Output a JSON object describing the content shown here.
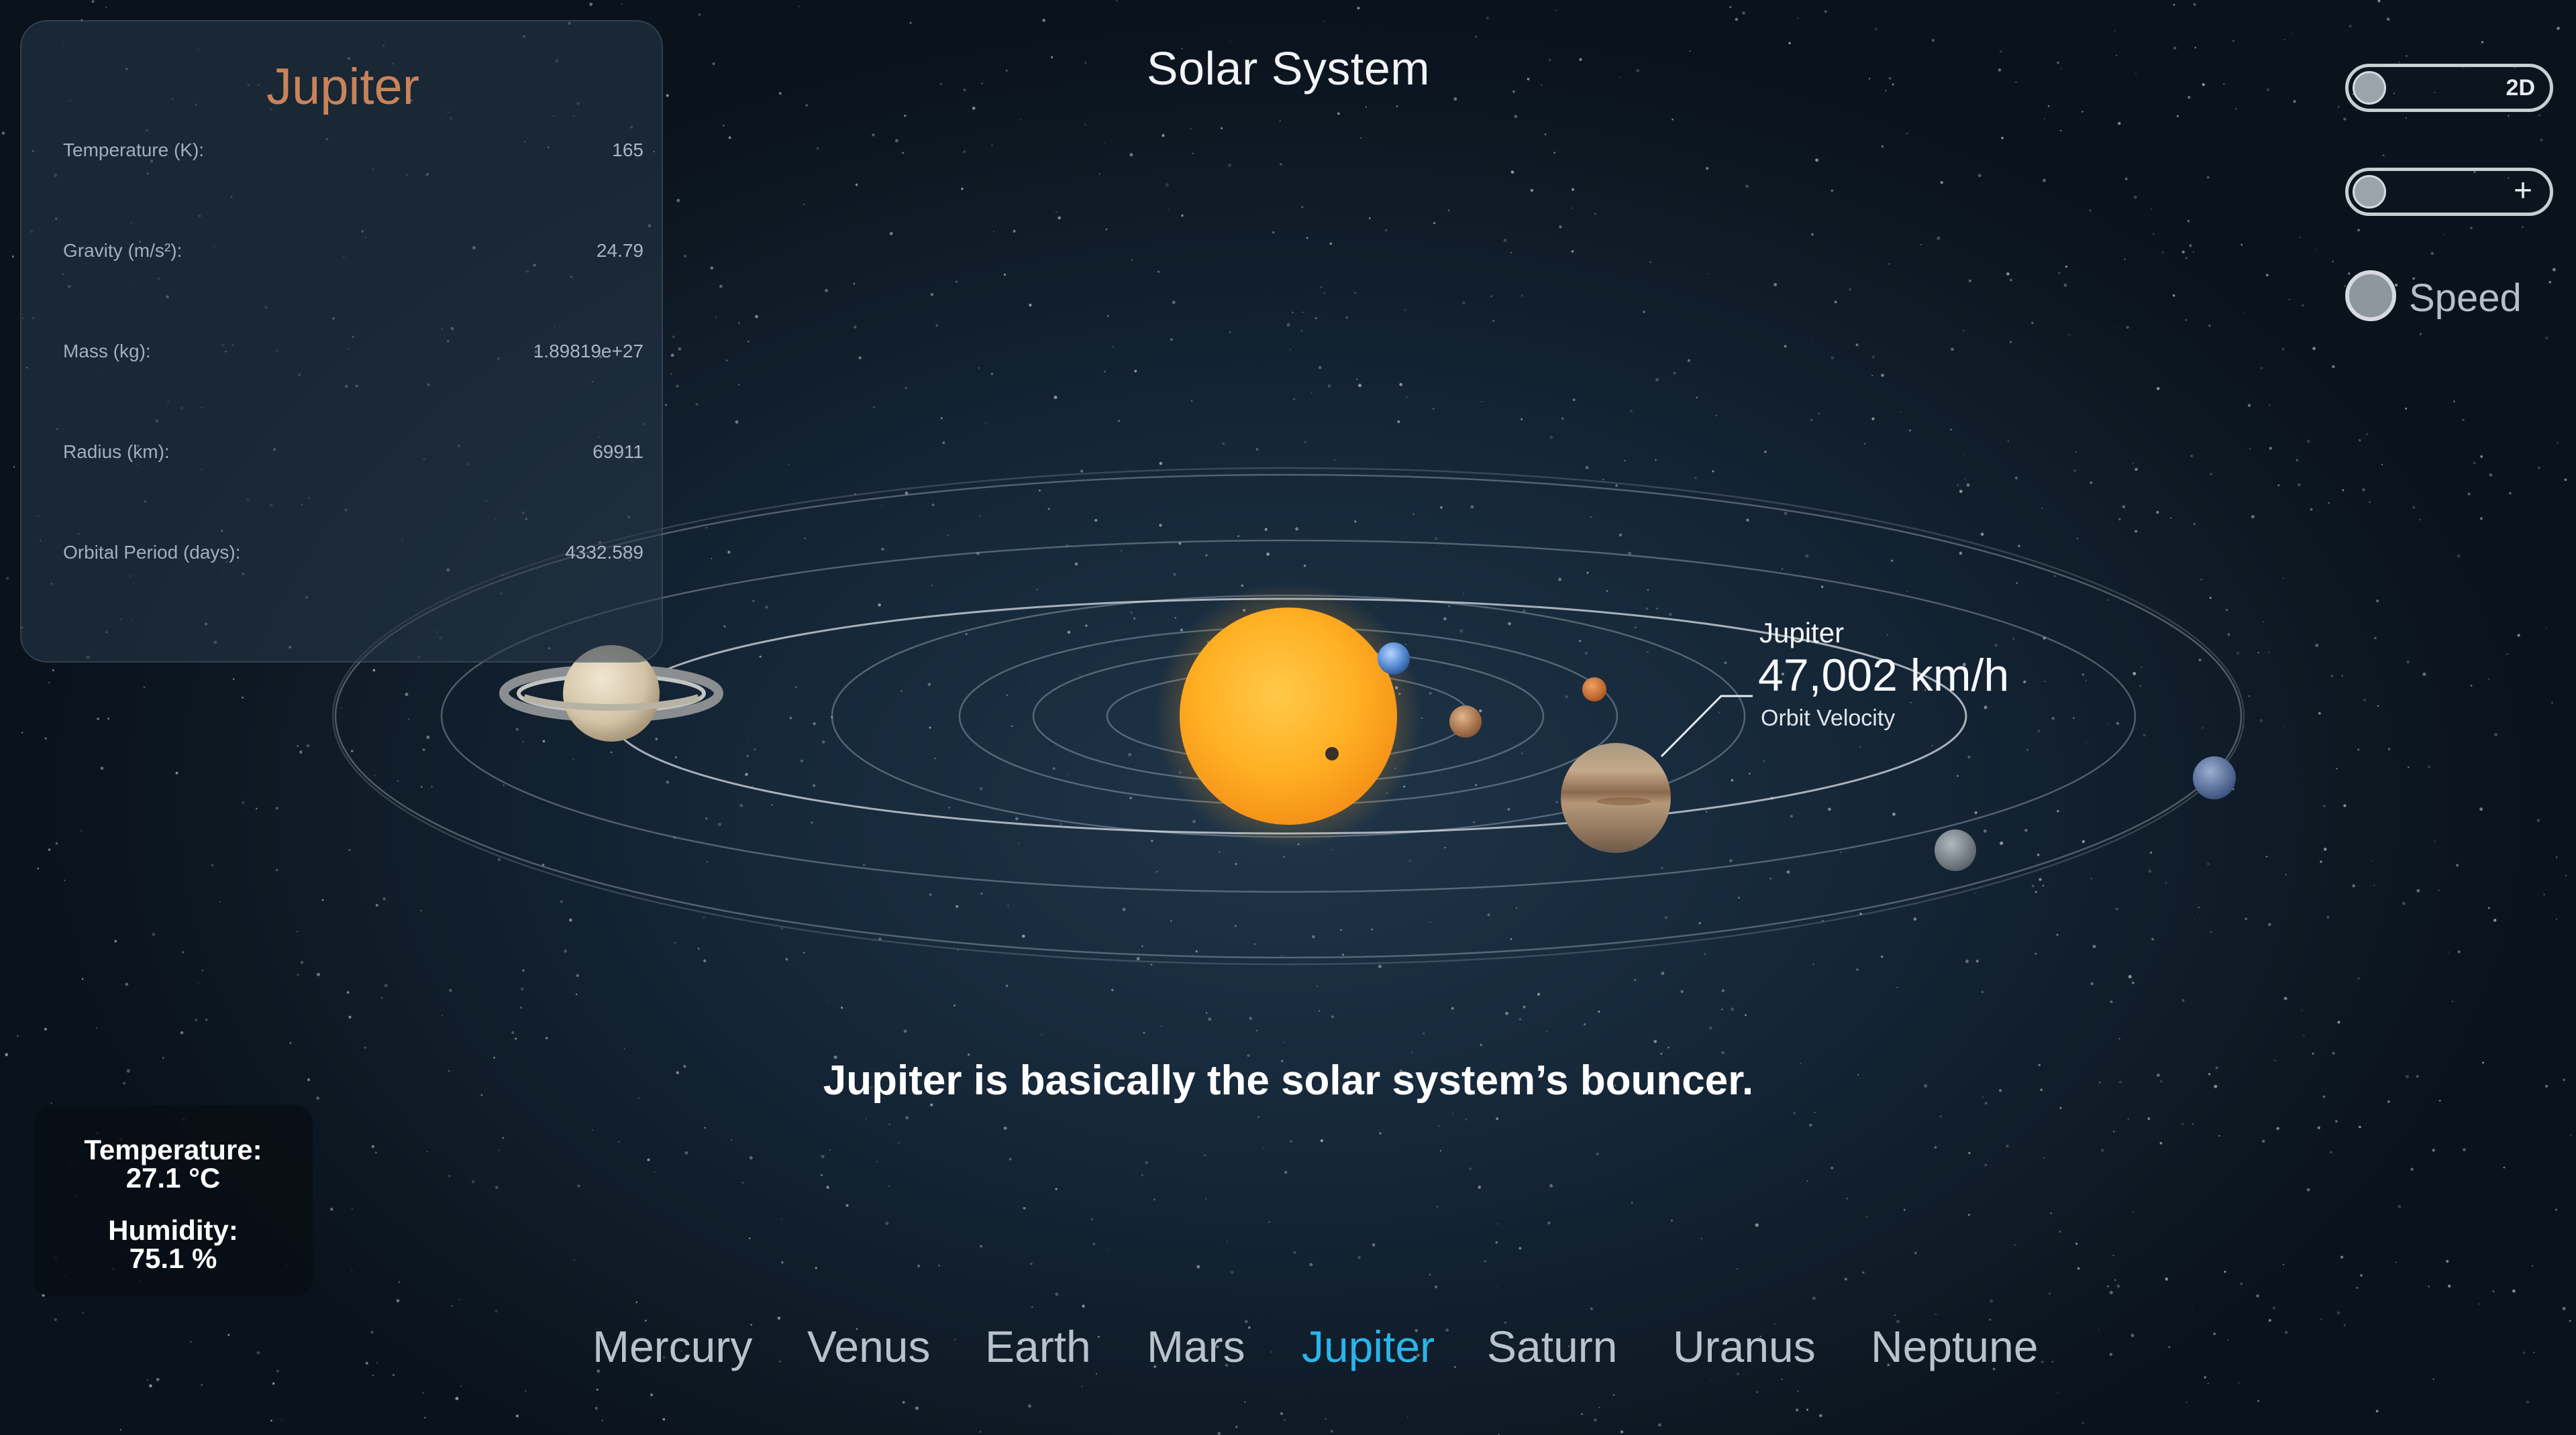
{
  "page": {
    "title": "Solar System"
  },
  "info_panel": {
    "planet_name": "Jupiter",
    "rows": [
      {
        "label": "Temperature (K):",
        "value": "165"
      },
      {
        "label": "Gravity (m/s²):",
        "value": "24.79"
      },
      {
        "label": "Mass (kg):",
        "value": "1.89819e+27"
      },
      {
        "label": "Radius (km):",
        "value": "69911"
      },
      {
        "label": "Orbital Period (days):",
        "value": "4332.589"
      }
    ]
  },
  "controls": {
    "view_toggle_label": "2D",
    "zoom_toggle_label": "+",
    "speed_label": "Speed"
  },
  "callout": {
    "planet": "Jupiter",
    "velocity": "47,002 km/h",
    "caption": "Orbit Velocity"
  },
  "fun_fact": "Jupiter is basically the solar system’s bouncer.",
  "sensor": {
    "temperature_label": "Temperature:",
    "temperature_value": "27.1 °C",
    "humidity_label": "Humidity:",
    "humidity_value": "75.1 %"
  },
  "planet_nav": {
    "items": [
      "Mercury",
      "Venus",
      "Earth",
      "Mars",
      "Jupiter",
      "Saturn",
      "Uranus",
      "Neptune"
    ],
    "active": "Jupiter"
  },
  "colors": {
    "accent": "#2ab4ea",
    "panel_title": "#c9835a",
    "sun": "#ffb22e"
  }
}
